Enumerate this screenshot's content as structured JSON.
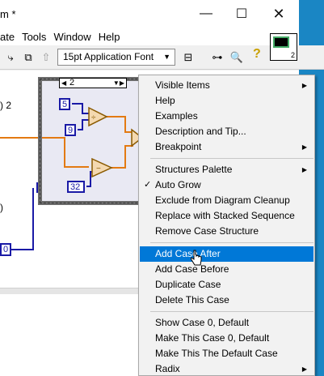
{
  "window": {
    "title": "m *",
    "minimize": "—",
    "maximize": "☐",
    "close": "✕"
  },
  "menubar": [
    {
      "label": "ate"
    },
    {
      "label": "Tools"
    },
    {
      "label": "Window"
    },
    {
      "label": "Help"
    }
  ],
  "toolbar": {
    "font_select": "15pt Application Font",
    "help_icon": "help-icon"
  },
  "vi_icon_number": "2",
  "diagram": {
    "case_selector": "2",
    "constants": [
      "5",
      "9",
      "32"
    ],
    "left_text_1": ") 2",
    "left_text_2": ")",
    "left_const": "0",
    "tunnel_label": "?"
  },
  "context_menu": {
    "items": [
      {
        "label": "Visible Items",
        "submenu": true
      },
      {
        "label": "Help"
      },
      {
        "label": "Examples"
      },
      {
        "label": "Description and Tip..."
      },
      {
        "label": "Breakpoint",
        "submenu": true
      },
      {
        "label": "Structures Palette",
        "submenu": true
      },
      {
        "label": "Auto Grow",
        "checked": true
      },
      {
        "label": "Exclude from Diagram Cleanup"
      },
      {
        "label": "Replace with Stacked Sequence"
      },
      {
        "label": "Remove Case Structure"
      },
      {
        "label": "Add Case After",
        "highlighted": true
      },
      {
        "label": "Add Case Before"
      },
      {
        "label": "Duplicate Case"
      },
      {
        "label": "Delete This Case"
      },
      {
        "label": "Show Case 0, Default"
      },
      {
        "label": "Make This Case 0, Default"
      },
      {
        "label": "Make This The Default Case"
      },
      {
        "label": "Radix",
        "submenu": true
      }
    ]
  },
  "colors": {
    "accent": "#0078d7",
    "wire_numeric": "#e37a12",
    "wire_int": "#1a1aa6",
    "desktop": "#1e7ab0"
  }
}
